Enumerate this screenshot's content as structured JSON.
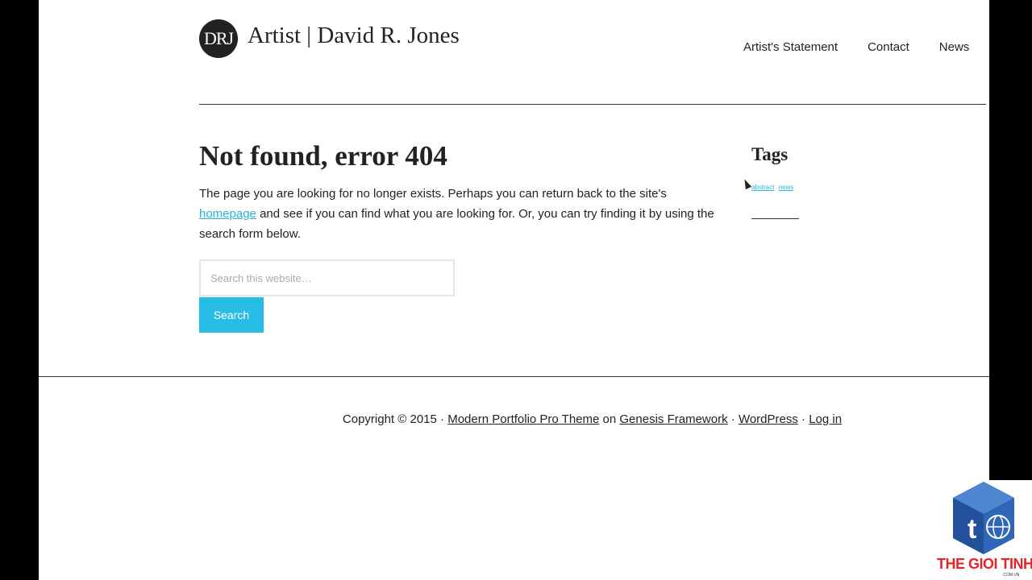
{
  "header": {
    "logo_text": "DRJ",
    "site_title": "Artist | David R. Jones",
    "nav": [
      "Artist's Statement",
      "Contact",
      "News"
    ]
  },
  "main": {
    "title": "Not found, error 404",
    "text_before_link": "The page you are looking for no longer exists. Perhaps you can return back to the site's ",
    "link_text": "homepage",
    "text_after_link": " and see if you can find what you are looking for. Or, you can try finding it by using the search form below.",
    "search": {
      "placeholder": "Search this website…",
      "button_label": "Search"
    }
  },
  "sidebar": {
    "widget_title": "Tags",
    "tags": [
      "abstract",
      "news"
    ]
  },
  "footer": {
    "copyright": "Copyright © 2015 · ",
    "theme_link": "Modern Portfolio Pro Theme",
    "on": " on ",
    "framework_link": "Genesis Framework",
    "sep1": " · ",
    "wordpress_link": "WordPress",
    "sep2": " · ",
    "login_link": "Log in"
  },
  "watermark": {
    "text": "THE GIOI TINHOC",
    "sub": ".COM.VN"
  },
  "colors": {
    "accent": "#27bde6",
    "link": "#27b4d6",
    "watermark_red": "#e0262c",
    "watermark_blue": "#2c5ea8"
  }
}
